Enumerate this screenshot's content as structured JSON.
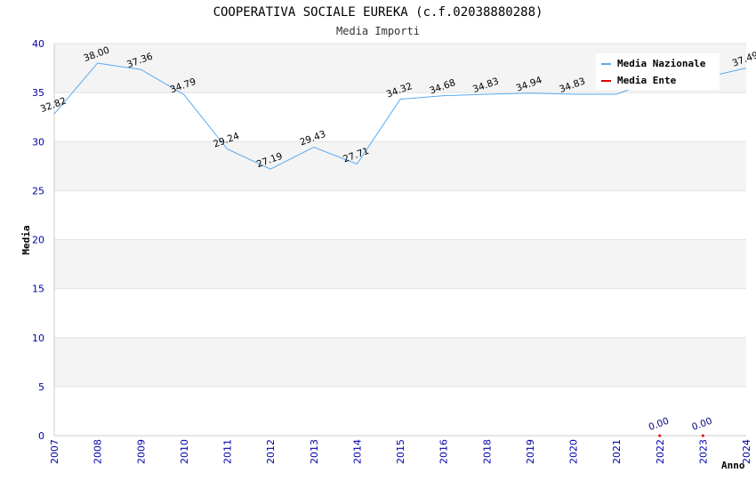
{
  "chart_data": {
    "type": "line",
    "title": "COOPERATIVA SOCIALE EUREKA (c.f.02038880288)",
    "subtitle": "Media Importi",
    "xlabel": "Anno",
    "ylabel": "Media",
    "ylim": [
      0,
      40
    ],
    "yticks": [
      "0",
      "5",
      "10",
      "15",
      "20",
      "25",
      "30",
      "35",
      "40"
    ],
    "categories": [
      "2007",
      "2008",
      "2009",
      "2010",
      "2011",
      "2012",
      "2013",
      "2014",
      "2015",
      "2016",
      "2018",
      "2019",
      "2020",
      "2021",
      "2022",
      "2023",
      "2024"
    ],
    "grid": true,
    "legend_position": "top-right",
    "series": [
      {
        "name": "Media Nazionale",
        "color": "#5aaaf0",
        "values": [
          32.82,
          38.0,
          37.36,
          34.79,
          29.24,
          27.19,
          29.43,
          27.71,
          34.32,
          34.68,
          34.83,
          34.94,
          34.83,
          34.83,
          36.5,
          36.5,
          37.49
        ],
        "labels": [
          "32.82",
          "38.00",
          "37.36",
          "34.79",
          "29.24",
          "27.19",
          "29.43",
          "27.71",
          "34.32",
          "34.68",
          "34.83",
          "34.94",
          "34.83",
          "",
          "",
          "",
          "37.49"
        ]
      },
      {
        "name": "Media Ente",
        "color": "#dd0000",
        "points": [
          {
            "x": "2022",
            "y": 0,
            "label": "0.00"
          },
          {
            "x": "2023",
            "y": 0,
            "label": "0.00"
          }
        ]
      }
    ]
  }
}
